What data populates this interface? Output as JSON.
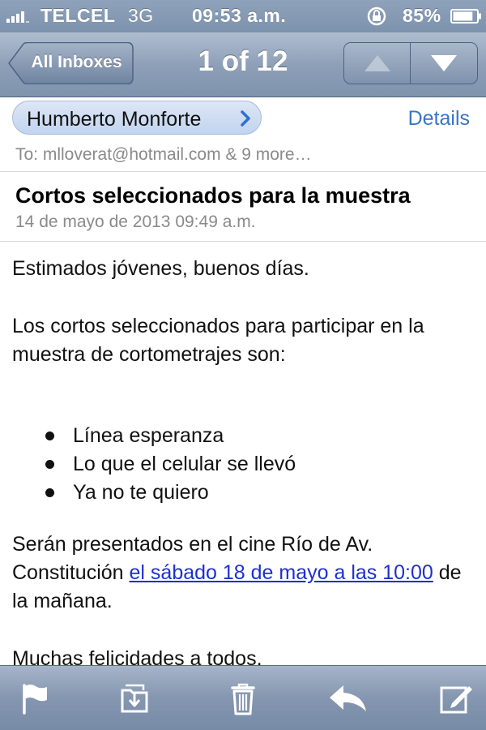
{
  "status_bar": {
    "carrier": "TELCEL",
    "network": "3G",
    "time": "09:53 a.m.",
    "battery": "85%",
    "battery_level": 0.85
  },
  "nav": {
    "back_label": "All Inboxes",
    "title": "1 of 12",
    "prev_icon": "arrow-up-icon",
    "next_icon": "arrow-down-icon"
  },
  "header": {
    "sender": "Humberto Monforte",
    "details_label": "Details",
    "to_line": "To: mlloverat@hotmail.com & 9 more…"
  },
  "message": {
    "subject": "Cortos seleccionados para la muestra",
    "date": "14 de mayo de 2013 09:49 a.m.",
    "greeting": "Estimados jóvenes, buenos días.",
    "intro": "Los cortos seleccionados para participar en la muestra de cortometrajes son:",
    "films": [
      "Línea esperanza",
      "Lo que el celular se llevó",
      "Ya no te quiero"
    ],
    "venue_text": "Serán presentados en el cine Río de Av. Constitución ",
    "date_link": "el sábado 18 de mayo a las 10:00",
    "venue_text_end": " de la mañana.",
    "closing": "Muchas felicidades a todos."
  },
  "toolbar": {
    "icons": [
      "flag-icon",
      "move-folder-icon",
      "trash-icon",
      "reply-icon",
      "compose-icon"
    ]
  },
  "colors": {
    "link": "#1f2fd1",
    "details": "#3975c6",
    "bar": "#8496b0"
  }
}
